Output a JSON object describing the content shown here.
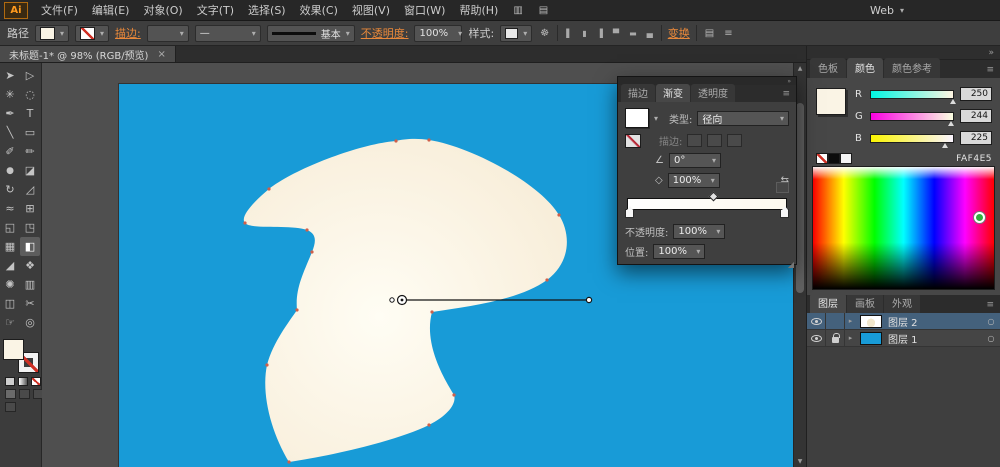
{
  "icons": {
    "caret": "▾",
    "close": "×",
    "collapse": "»",
    "panel_menu": "≡",
    "bridge": "▥",
    "arrange": "▤",
    "recolor": "☸",
    "angle": "∠",
    "aspect": "◇",
    "reverse": "⇆",
    "expand_arrow": "▸",
    "target": "○",
    "scroll_up": "▲",
    "scroll_down": "▼",
    "resize_grip": "◢",
    "align_left": "▌",
    "align_center_h": "▮",
    "align_right": "▐",
    "align_top": "▀",
    "align_middle": "▬",
    "align_bottom": "▄"
  },
  "app": {
    "logo": "Ai",
    "menus": [
      "文件(F)",
      "编辑(E)",
      "对象(O)",
      "文字(T)",
      "选择(S)",
      "效果(C)",
      "视图(V)",
      "窗口(W)",
      "帮助(H)"
    ],
    "workspace": "Web"
  },
  "control_bar": {
    "context_label": "路径",
    "stroke_label": "描边:",
    "width_profile_value": "—",
    "brush_value": "基本",
    "opacity_label": "不透明度:",
    "opacity_value": "100%",
    "style_label": "样式:",
    "transform_label": "变换"
  },
  "document": {
    "tab_title": "未标题-1* @ 98% (RGB/预览)"
  },
  "tools": [
    {
      "name": "selection",
      "glyph": "➤"
    },
    {
      "name": "direct-selection",
      "glyph": "▷"
    },
    {
      "name": "magic-wand",
      "glyph": "✳"
    },
    {
      "name": "lasso",
      "glyph": "◌"
    },
    {
      "name": "pen",
      "glyph": "✒"
    },
    {
      "name": "type",
      "glyph": "T"
    },
    {
      "name": "line-segment",
      "glyph": "╲"
    },
    {
      "name": "rectangle",
      "glyph": "▭"
    },
    {
      "name": "paintbrush",
      "glyph": "✐"
    },
    {
      "name": "pencil",
      "glyph": "✏"
    },
    {
      "name": "blob-brush",
      "glyph": "●"
    },
    {
      "name": "eraser",
      "glyph": "◪"
    },
    {
      "name": "rotate",
      "glyph": "↻"
    },
    {
      "name": "scale",
      "glyph": "◿"
    },
    {
      "name": "width",
      "glyph": "≈"
    },
    {
      "name": "free-transform",
      "glyph": "⊞"
    },
    {
      "name": "shape-builder",
      "glyph": "◱"
    },
    {
      "name": "perspective-grid",
      "glyph": "◳"
    },
    {
      "name": "mesh",
      "glyph": "▦"
    },
    {
      "name": "gradient",
      "glyph": "◧"
    },
    {
      "name": "eyedropper",
      "glyph": "◢"
    },
    {
      "name": "blend",
      "glyph": "❖"
    },
    {
      "name": "symbol-sprayer",
      "glyph": "✺"
    },
    {
      "name": "column-graph",
      "glyph": "▥"
    },
    {
      "name": "artboard",
      "glyph": "◫"
    },
    {
      "name": "slice",
      "glyph": "✂"
    },
    {
      "name": "hand",
      "glyph": "☞"
    },
    {
      "name": "zoom",
      "glyph": "◎"
    }
  ],
  "gradient_panel": {
    "tabs": [
      "描边",
      "渐变",
      "透明度"
    ],
    "active_tab": "渐变",
    "type_label": "类型:",
    "type_value": "径向",
    "stroke_label": "描边:",
    "angle_value": "0°",
    "aspect_value": "100%",
    "opacity_label": "不透明度:",
    "opacity_value": "100%",
    "location_label": "位置:",
    "location_value": "100%"
  },
  "color_panel": {
    "tabs": [
      "色板",
      "颜色",
      "颜色参考"
    ],
    "active_tab": "颜色",
    "channels": [
      {
        "label": "R",
        "value": "250"
      },
      {
        "label": "G",
        "value": "244"
      },
      {
        "label": "B",
        "value": "225"
      }
    ],
    "hex": "FAF4E5"
  },
  "layers_panel": {
    "tabs": [
      "图层",
      "画板",
      "外观"
    ],
    "active_tab": "图层",
    "layers": [
      {
        "name": "图层 2",
        "selected": true,
        "locked": false
      },
      {
        "name": "图层 1",
        "selected": false,
        "locked": true
      }
    ]
  },
  "canvas": {
    "artboard_color": "#189BD7",
    "shape_fill": "#FAF4E5",
    "gradient_type": "radial"
  },
  "colors": {
    "accent_orange": "#E8883A",
    "artboard_blue": "#189BD7",
    "shape_cream": "#FAF4E5",
    "ui_dark": "#3C3C3C"
  }
}
